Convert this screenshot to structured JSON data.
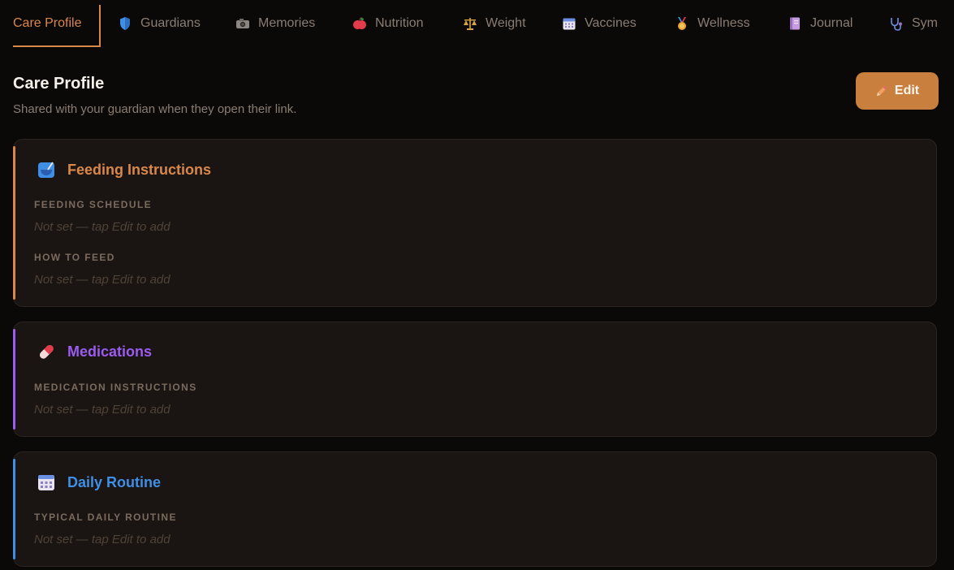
{
  "tabs": [
    {
      "label": "Care Profile",
      "icon": "none"
    },
    {
      "label": "Guardians",
      "icon": "shield-icon"
    },
    {
      "label": "Memories",
      "icon": "camera-icon"
    },
    {
      "label": "Nutrition",
      "icon": "apple-icon"
    },
    {
      "label": "Weight",
      "icon": "scale-icon"
    },
    {
      "label": "Vaccines",
      "icon": "calendar-icon"
    },
    {
      "label": "Wellness",
      "icon": "medal-icon"
    },
    {
      "label": "Journal",
      "icon": "notebook-icon"
    },
    {
      "label": "Sym",
      "icon": "stethoscope-icon"
    }
  ],
  "header": {
    "title": "Care Profile",
    "subtitle": "Shared with your guardian when they open their link.",
    "edit_label": "Edit"
  },
  "cards": {
    "feeding": {
      "title": "Feeding Instructions",
      "accent": "#d9884a",
      "fields": [
        {
          "label": "FEEDING SCHEDULE",
          "value": "Not set — tap Edit to add"
        },
        {
          "label": "HOW TO FEED",
          "value": "Not set — tap Edit to add"
        }
      ]
    },
    "medications": {
      "title": "Medications",
      "accent": "#9b5cf0",
      "fields": [
        {
          "label": "MEDICATION INSTRUCTIONS",
          "value": "Not set — tap Edit to add"
        }
      ]
    },
    "routine": {
      "title": "Daily Routine",
      "accent": "#3f8fe6",
      "fields": [
        {
          "label": "TYPICAL DAILY ROUTINE",
          "value": "Not set — tap Edit to add"
        }
      ]
    }
  }
}
